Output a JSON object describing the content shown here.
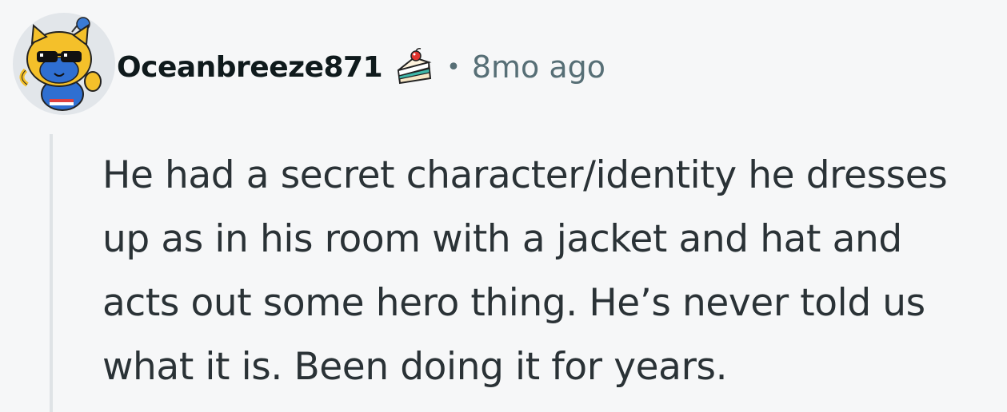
{
  "comment": {
    "username": "Oceanbreeze871",
    "separator": "•",
    "timestamp": "8mo ago",
    "body_lines": [
      "He had a secret character/identity he dresses",
      "up as in his room with a jacket and hat and",
      "acts out some hero thing. He’s never told us",
      "what it is. Been doing it for years."
    ],
    "avatar_icon": "snoo-avatar-icon",
    "flair_icon": "cake-icon"
  },
  "colors": {
    "background": "#f6f7f8",
    "username": "#0f1a1c",
    "meta": "#576f76",
    "body_text": "#2a3236",
    "thread_line": "#dfe3e6"
  }
}
